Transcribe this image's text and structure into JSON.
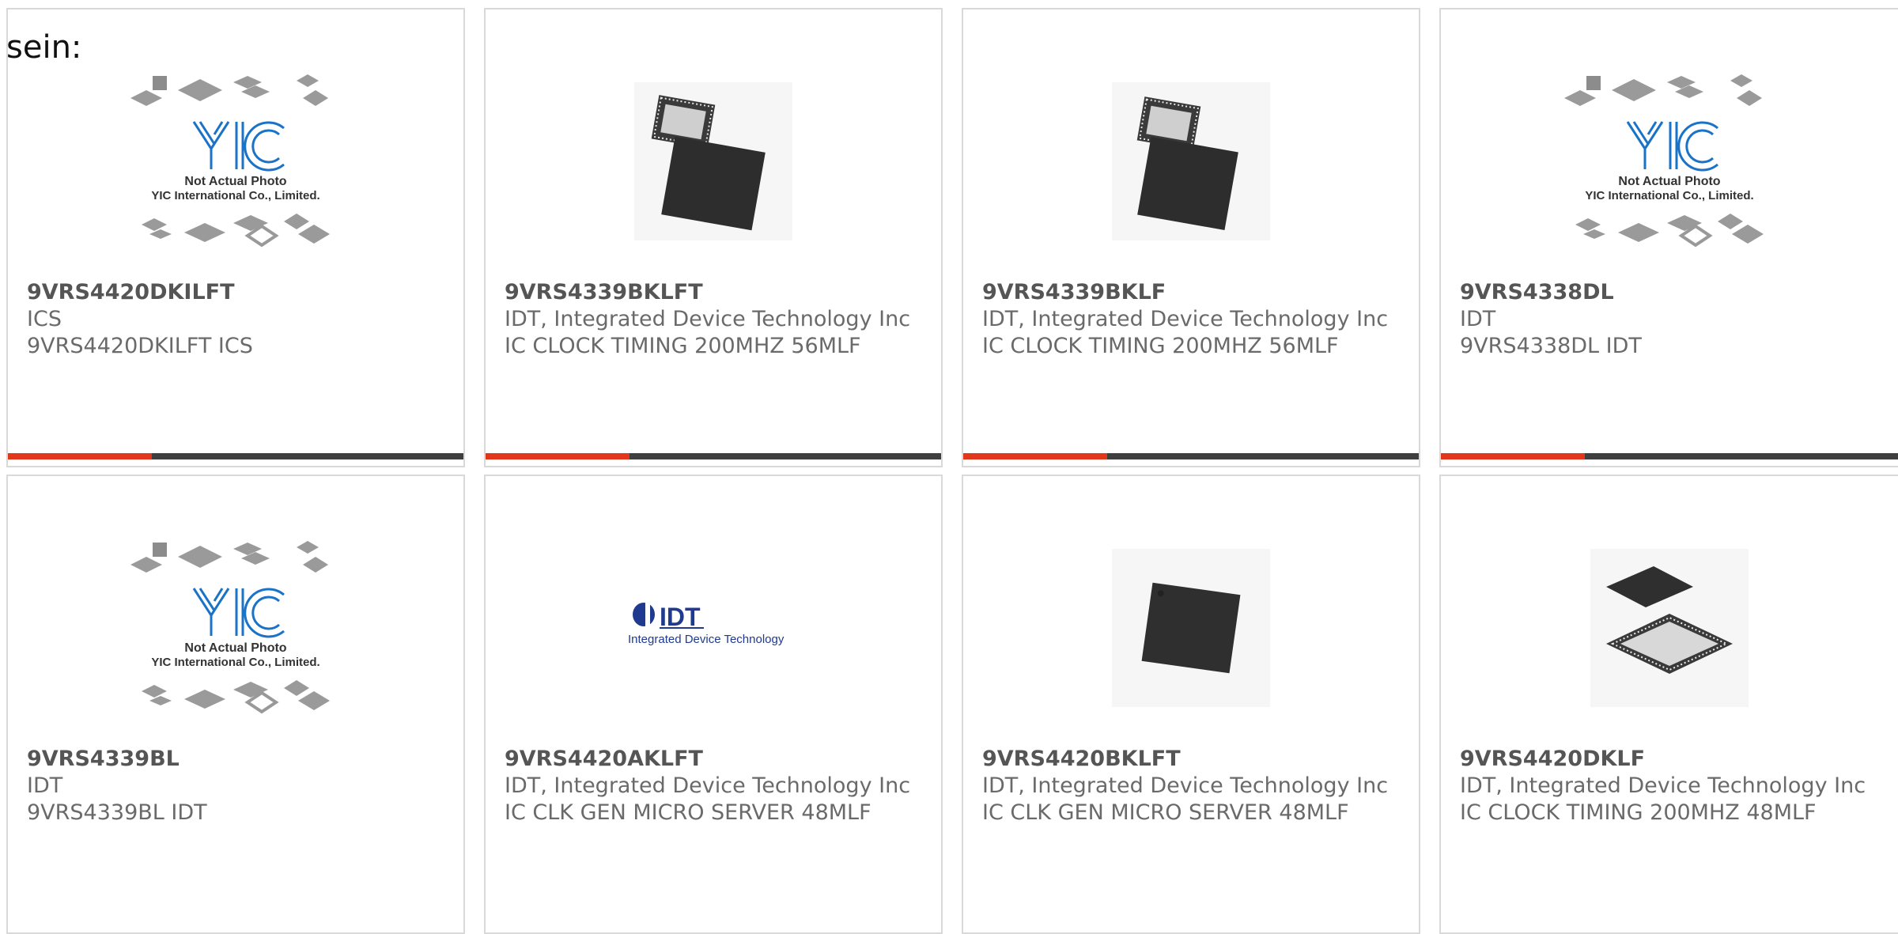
{
  "heading": "sein:",
  "colors": {
    "accent": "#e2371a",
    "bar": "#3f3f3f",
    "border": "#d9d9d9",
    "yic_blue": "#1a73c7",
    "idt_blue": "#1f3a8f"
  },
  "cards": [
    {
      "part": "9VRS4420DKILFT",
      "manufacturer": "ICS",
      "description": "9VRS4420DKILFT ICS",
      "image": "yic-placeholder-icon",
      "placeholder_text": [
        "YIC",
        "Not Actual Photo",
        "YIC International Co., Limited."
      ]
    },
    {
      "part": "9VRS4339BKLFT",
      "manufacturer": "IDT, Integrated Device Technology Inc",
      "description": "IC CLOCK TIMING 200MHZ 56MLF",
      "image": "qfn-chip-pair-icon"
    },
    {
      "part": "9VRS4339BKLF",
      "manufacturer": "IDT, Integrated Device Technology Inc",
      "description": "IC CLOCK TIMING 200MHZ 56MLF",
      "image": "qfn-chip-pair-icon"
    },
    {
      "part": "9VRS4338DL",
      "manufacturer": "IDT",
      "description": "9VRS4338DL IDT",
      "image": "yic-placeholder-icon",
      "placeholder_text": [
        "YIC",
        "Not Actual Photo",
        "YIC International Co., Limited."
      ]
    },
    {
      "part": "9VRS4339BL",
      "manufacturer": "IDT",
      "description": "9VRS4339BL IDT",
      "image": "yic-placeholder-icon",
      "placeholder_text": [
        "YIC",
        "Not Actual Photo",
        "YIC International Co., Limited."
      ]
    },
    {
      "part": "9VRS4420AKLFT",
      "manufacturer": "IDT, Integrated Device Technology Inc",
      "description": "IC CLK GEN MICRO SERVER 48MLF",
      "image": "idt-logo-icon",
      "logo_text": [
        "IDT",
        "Integrated Device Technology"
      ]
    },
    {
      "part": "9VRS4420BKLFT",
      "manufacturer": "IDT, Integrated Device Technology Inc",
      "description": "IC CLK GEN MICRO SERVER 48MLF",
      "image": "qfn-chip-single-icon"
    },
    {
      "part": "9VRS4420DKLF",
      "manufacturer": "IDT, Integrated Device Technology Inc",
      "description": "IC CLOCK TIMING 200MHZ 48MLF",
      "image": "qfn-chip-pair-flat-icon"
    }
  ]
}
